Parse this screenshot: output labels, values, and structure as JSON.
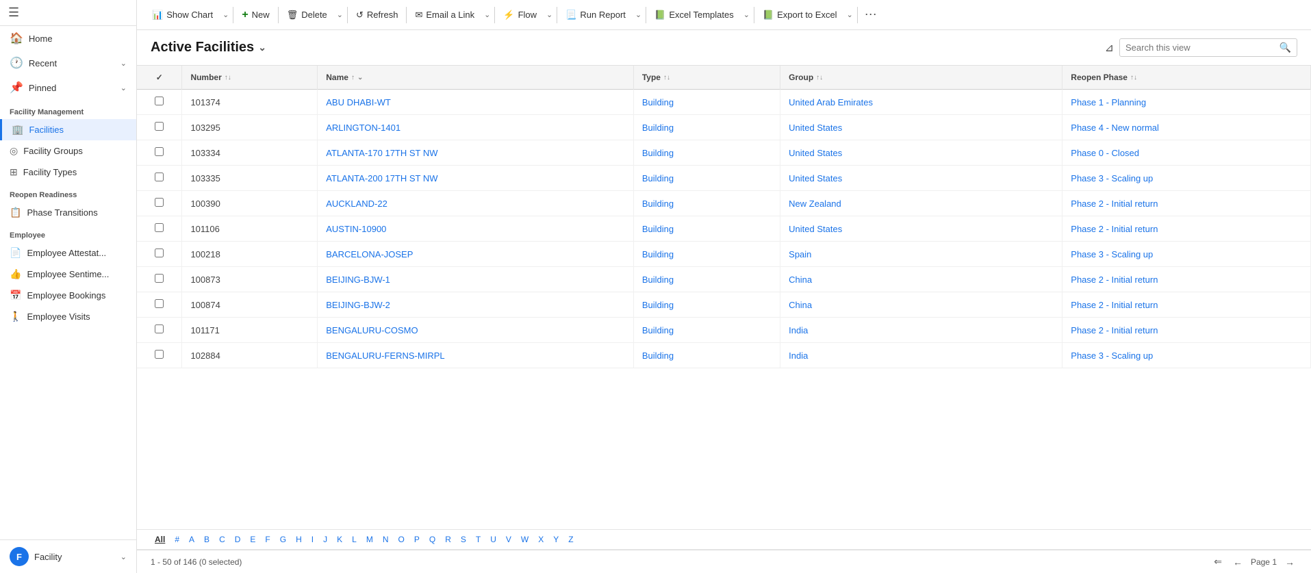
{
  "sidebar": {
    "hamburger": "☰",
    "nav_items": [
      {
        "id": "home",
        "icon": "🏠",
        "label": "Home",
        "chevron": ""
      },
      {
        "id": "recent",
        "icon": "🕐",
        "label": "Recent",
        "chevron": "⌄"
      },
      {
        "id": "pinned",
        "icon": "📌",
        "label": "Pinned",
        "chevron": "⌄"
      }
    ],
    "sections": [
      {
        "label": "Facility Management",
        "items": [
          {
            "id": "facilities",
            "icon": "🏢",
            "label": "Facilities",
            "active": true
          },
          {
            "id": "facility-groups",
            "icon": "◎",
            "label": "Facility Groups",
            "active": false
          },
          {
            "id": "facility-types",
            "icon": "⊞",
            "label": "Facility Types",
            "active": false
          }
        ]
      },
      {
        "label": "Reopen Readiness",
        "items": [
          {
            "id": "phase-transitions",
            "icon": "📋",
            "label": "Phase Transitions",
            "active": false
          }
        ]
      },
      {
        "label": "Employee",
        "items": [
          {
            "id": "employee-attestat",
            "icon": "📄",
            "label": "Employee Attestat...",
            "active": false
          },
          {
            "id": "employee-sentime",
            "icon": "👍",
            "label": "Employee Sentime...",
            "active": false
          },
          {
            "id": "employee-bookings",
            "icon": "📅",
            "label": "Employee Bookings",
            "active": false
          },
          {
            "id": "employee-visits",
            "icon": "🚶",
            "label": "Employee Visits",
            "active": false
          }
        ]
      }
    ],
    "footer": {
      "avatar": "F",
      "label": "Facility",
      "chevron": "⌄"
    }
  },
  "toolbar": {
    "buttons": [
      {
        "id": "show-chart",
        "icon": "📊",
        "label": "Show Chart",
        "has_chevron": true
      },
      {
        "id": "new",
        "icon": "+",
        "label": "New",
        "has_chevron": false,
        "is_plus": true
      },
      {
        "id": "delete",
        "icon": "🗑",
        "label": "Delete",
        "has_chevron": true
      },
      {
        "id": "refresh",
        "icon": "↺",
        "label": "Refresh",
        "has_chevron": false
      },
      {
        "id": "email-link",
        "icon": "✉",
        "label": "Email a Link",
        "has_chevron": true
      },
      {
        "id": "flow",
        "icon": "⚡",
        "label": "Flow",
        "has_chevron": true
      },
      {
        "id": "run-report",
        "icon": "📃",
        "label": "Run Report",
        "has_chevron": true
      },
      {
        "id": "excel-templates",
        "icon": "📗",
        "label": "Excel Templates",
        "has_chevron": true
      },
      {
        "id": "export-excel",
        "icon": "📗",
        "label": "Export to Excel",
        "has_chevron": true
      }
    ],
    "more": "⋯"
  },
  "view": {
    "title": "Active Facilities",
    "title_chevron": "⌄",
    "search_placeholder": "Search this view"
  },
  "table": {
    "columns": [
      {
        "id": "check",
        "label": "✓",
        "sortable": false
      },
      {
        "id": "number",
        "label": "Number",
        "sort": "↑↓"
      },
      {
        "id": "name",
        "label": "Name",
        "sort": "↑"
      },
      {
        "id": "type",
        "label": "Type",
        "sort": "↑↓"
      },
      {
        "id": "group",
        "label": "Group",
        "sort": "↑↓"
      },
      {
        "id": "reopen-phase",
        "label": "Reopen Phase",
        "sort": "↑↓"
      }
    ],
    "rows": [
      {
        "number": "101374",
        "name": "ABU DHABI-WT",
        "type": "Building",
        "group": "United Arab Emirates",
        "phase": "Phase 1 - Planning"
      },
      {
        "number": "103295",
        "name": "ARLINGTON-1401",
        "type": "Building",
        "group": "United States",
        "phase": "Phase 4 - New normal"
      },
      {
        "number": "103334",
        "name": "ATLANTA-170 17TH ST NW",
        "type": "Building",
        "group": "United States",
        "phase": "Phase 0 - Closed"
      },
      {
        "number": "103335",
        "name": "ATLANTA-200 17TH ST NW",
        "type": "Building",
        "group": "United States",
        "phase": "Phase 3 - Scaling up"
      },
      {
        "number": "100390",
        "name": "AUCKLAND-22",
        "type": "Building",
        "group": "New Zealand",
        "phase": "Phase 2 - Initial return"
      },
      {
        "number": "101106",
        "name": "AUSTIN-10900",
        "type": "Building",
        "group": "United States",
        "phase": "Phase 2 - Initial return"
      },
      {
        "number": "100218",
        "name": "BARCELONA-JOSEP",
        "type": "Building",
        "group": "Spain",
        "phase": "Phase 3 - Scaling up"
      },
      {
        "number": "100873",
        "name": "BEIJING-BJW-1",
        "type": "Building",
        "group": "China",
        "phase": "Phase 2 - Initial return"
      },
      {
        "number": "100874",
        "name": "BEIJING-BJW-2",
        "type": "Building",
        "group": "China",
        "phase": "Phase 2 - Initial return"
      },
      {
        "number": "101171",
        "name": "BENGALURU-COSMO",
        "type": "Building",
        "group": "India",
        "phase": "Phase 2 - Initial return"
      },
      {
        "number": "102884",
        "name": "BENGALURU-FERNS-MIRPL",
        "type": "Building",
        "group": "India",
        "phase": "Phase 3 - Scaling up"
      }
    ]
  },
  "alpha_nav": {
    "active": "All",
    "items": [
      "All",
      "#",
      "A",
      "B",
      "C",
      "D",
      "E",
      "F",
      "G",
      "H",
      "I",
      "J",
      "K",
      "L",
      "M",
      "N",
      "O",
      "P",
      "Q",
      "R",
      "S",
      "T",
      "U",
      "V",
      "W",
      "X",
      "Y",
      "Z"
    ]
  },
  "footer": {
    "range_text": "1 - 50 of 146 (0 selected)",
    "page_label": "Page 1",
    "first_icon": "⇐",
    "prev_icon": "←",
    "next_icon": "→"
  }
}
